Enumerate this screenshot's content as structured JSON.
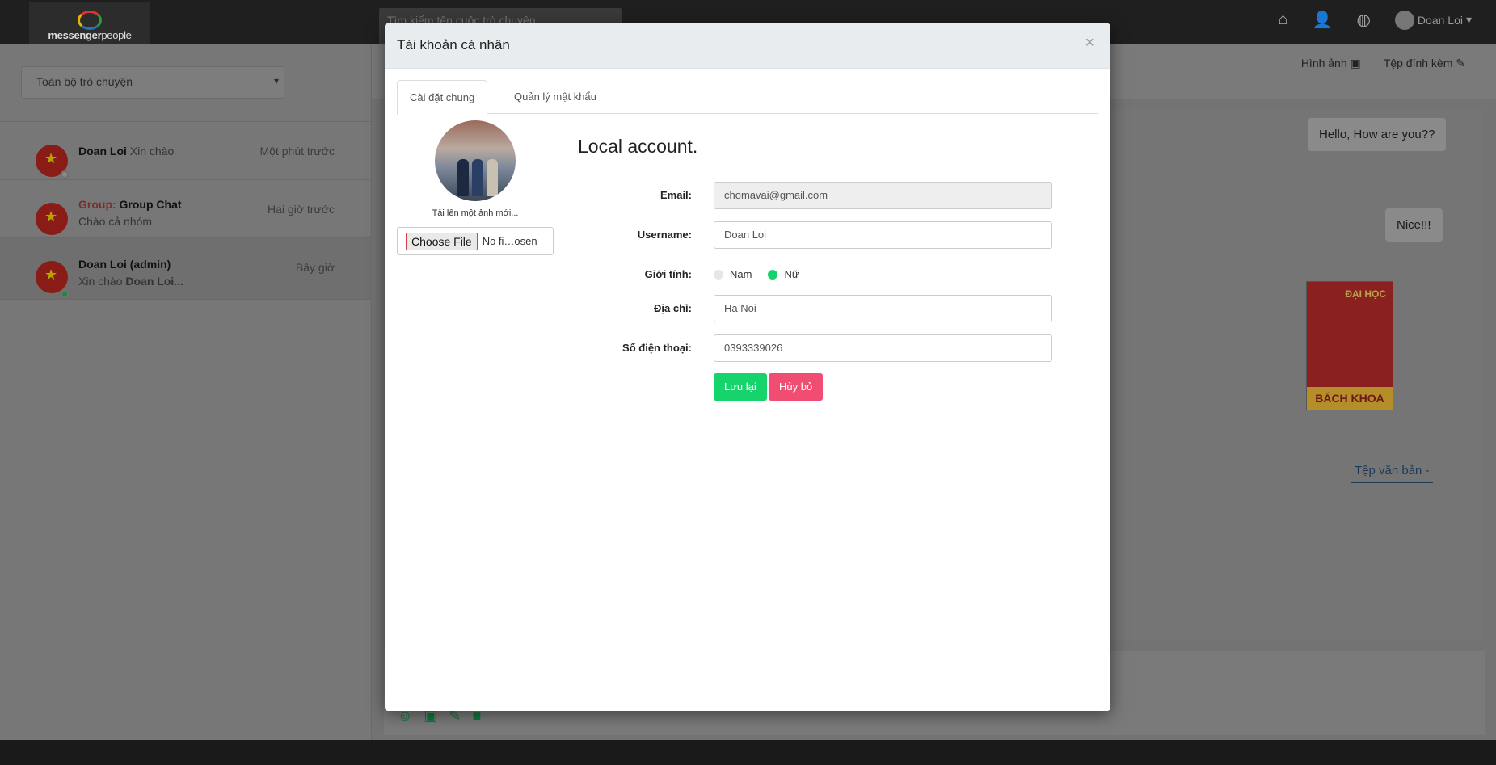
{
  "app": {
    "logo_text": "messenger",
    "logo_text_light": "people",
    "search_placeholder": "Tìm kiếm tên cuộc trò chuyện",
    "user_name": "Doan Loi"
  },
  "sidebar": {
    "filter": "Toàn bộ trò chuyện",
    "conversations": [
      {
        "name": "Doan Loi",
        "preview": "Xin chào",
        "time": "Một phút trước"
      },
      {
        "group_prefix": "Group:",
        "name": "Group Chat",
        "preview": "Chào cả nhóm",
        "time": "Hai giờ trước"
      },
      {
        "name": "Doan Loi (admin)",
        "preview_prefix": "Xin chào",
        "preview_bold": "Doan Loi...",
        "time": "Bây giờ"
      }
    ]
  },
  "chat": {
    "links": {
      "images": "Hình ảnh",
      "attachments": "Tệp đính kèm"
    },
    "messages": [
      "Hello, How are you??",
      "Nice!!!"
    ],
    "image_text": {
      "top": "ĐẠI HỌC",
      "bottom": "BÁCH KHOA"
    },
    "file_link": "Tệp văn bản -"
  },
  "modal": {
    "title": "Tài khoản cá nhân",
    "close": "×",
    "tabs": [
      "Cài đặt chung",
      "Quản lý mật khẩu"
    ],
    "upload_caption": "Tải lên một ảnh mới...",
    "file_button": "Choose File",
    "file_status": "No fi…osen",
    "heading": "Local account.",
    "fields": {
      "email_label": "Email:",
      "email_value": "chomavai@gmail.com",
      "username_label": "Username:",
      "username_value": "Doan Loi",
      "gender_label": "Giới tính:",
      "gender_male": "Nam",
      "gender_female": "Nữ",
      "address_label": "Địa chỉ:",
      "address_value": "Ha Noi",
      "phone_label": "Số điện thoại:",
      "phone_value": "0393339026"
    },
    "save_label": "Lưu lại",
    "cancel_label": "Hủy bỏ"
  },
  "colors": {
    "save": "#16d36c",
    "cancel": "#f14d72",
    "radio_selected": "#13d36c"
  }
}
